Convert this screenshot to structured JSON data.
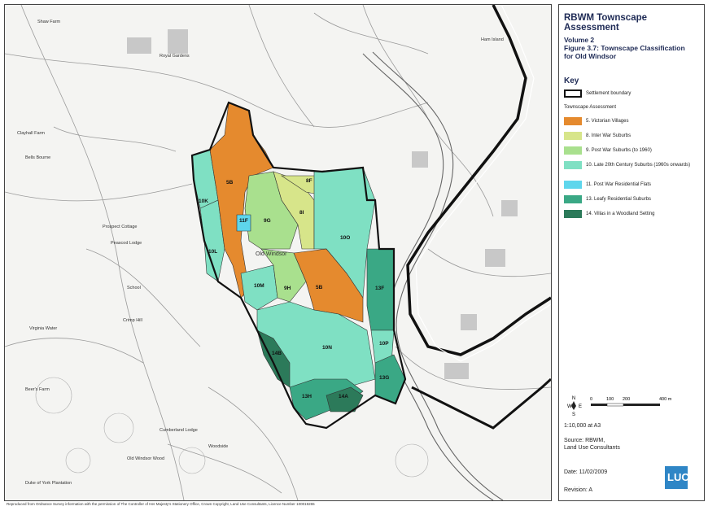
{
  "legend": {
    "title": "RBWM Townscape Assessment",
    "volume": "Volume 2",
    "figure": "Figure 3.7: Townscape Classification",
    "figure_line2": "for Old Windsor",
    "key_heading": "Key",
    "settlement_boundary": "Settlement boundary",
    "group_heading": "Townscape Assessment",
    "items": [
      {
        "label": "5. Victorian Villages",
        "color": "#e58a2e"
      },
      {
        "label": "8. Inter War Suburbs",
        "color": "#d7e58a"
      },
      {
        "label": "9. Post War Suburbs (to 1960)",
        "color": "#a9e08e"
      },
      {
        "label": "10. Late 20th Century Suburbs (1960s onwards)",
        "color": "#7fe0c3"
      },
      {
        "label": "11. Post War Residential Flats",
        "color": "#5ed6ec"
      },
      {
        "label": "13. Leafy Residential Suburbs",
        "color": "#3aa885"
      },
      {
        "label": "14. Villas in a Woodland Setting",
        "color": "#2c7a5a"
      }
    ],
    "scale_ticks": [
      "0",
      "100",
      "200",
      "400 m"
    ],
    "north": "N",
    "compass_w": "W",
    "compass_e": "E",
    "compass_s": "S",
    "scale": "1:10,000  at A3",
    "source_line1": "Source: RBWM,",
    "source_line2": "Land Use Consultants",
    "date": "Date: 11/02/2009",
    "revision": "Revision: A",
    "logo": "LUC"
  },
  "map": {
    "place_labels": [
      "Shaw Farm",
      "Royal Gardens",
      "Ham Island",
      "Old Windsor",
      "Clayhall Farm",
      "Bells Bourne",
      "Prospect Cottage",
      "Peascod Lodge",
      "School",
      "Virginia Water",
      "Crimp Hill",
      "Beer's Farm",
      "Woodside",
      "Cumberland Lodge",
      "Duke of York Plantation",
      "Old Windsor Wood"
    ],
    "zones": [
      "5B",
      "10K",
      "10L",
      "11F",
      "9G",
      "8I",
      "8F",
      "10O",
      "10M",
      "9H",
      "5B",
      "13F",
      "10N",
      "10P",
      "13G",
      "13H",
      "14A",
      "14B"
    ]
  },
  "copyright": "Reproduced from Ordnance Survey information with the permission of The Controller of Her Majesty's Stationery Office, Crown Copyright, Land Use Consultants, Licence Number 100019265"
}
